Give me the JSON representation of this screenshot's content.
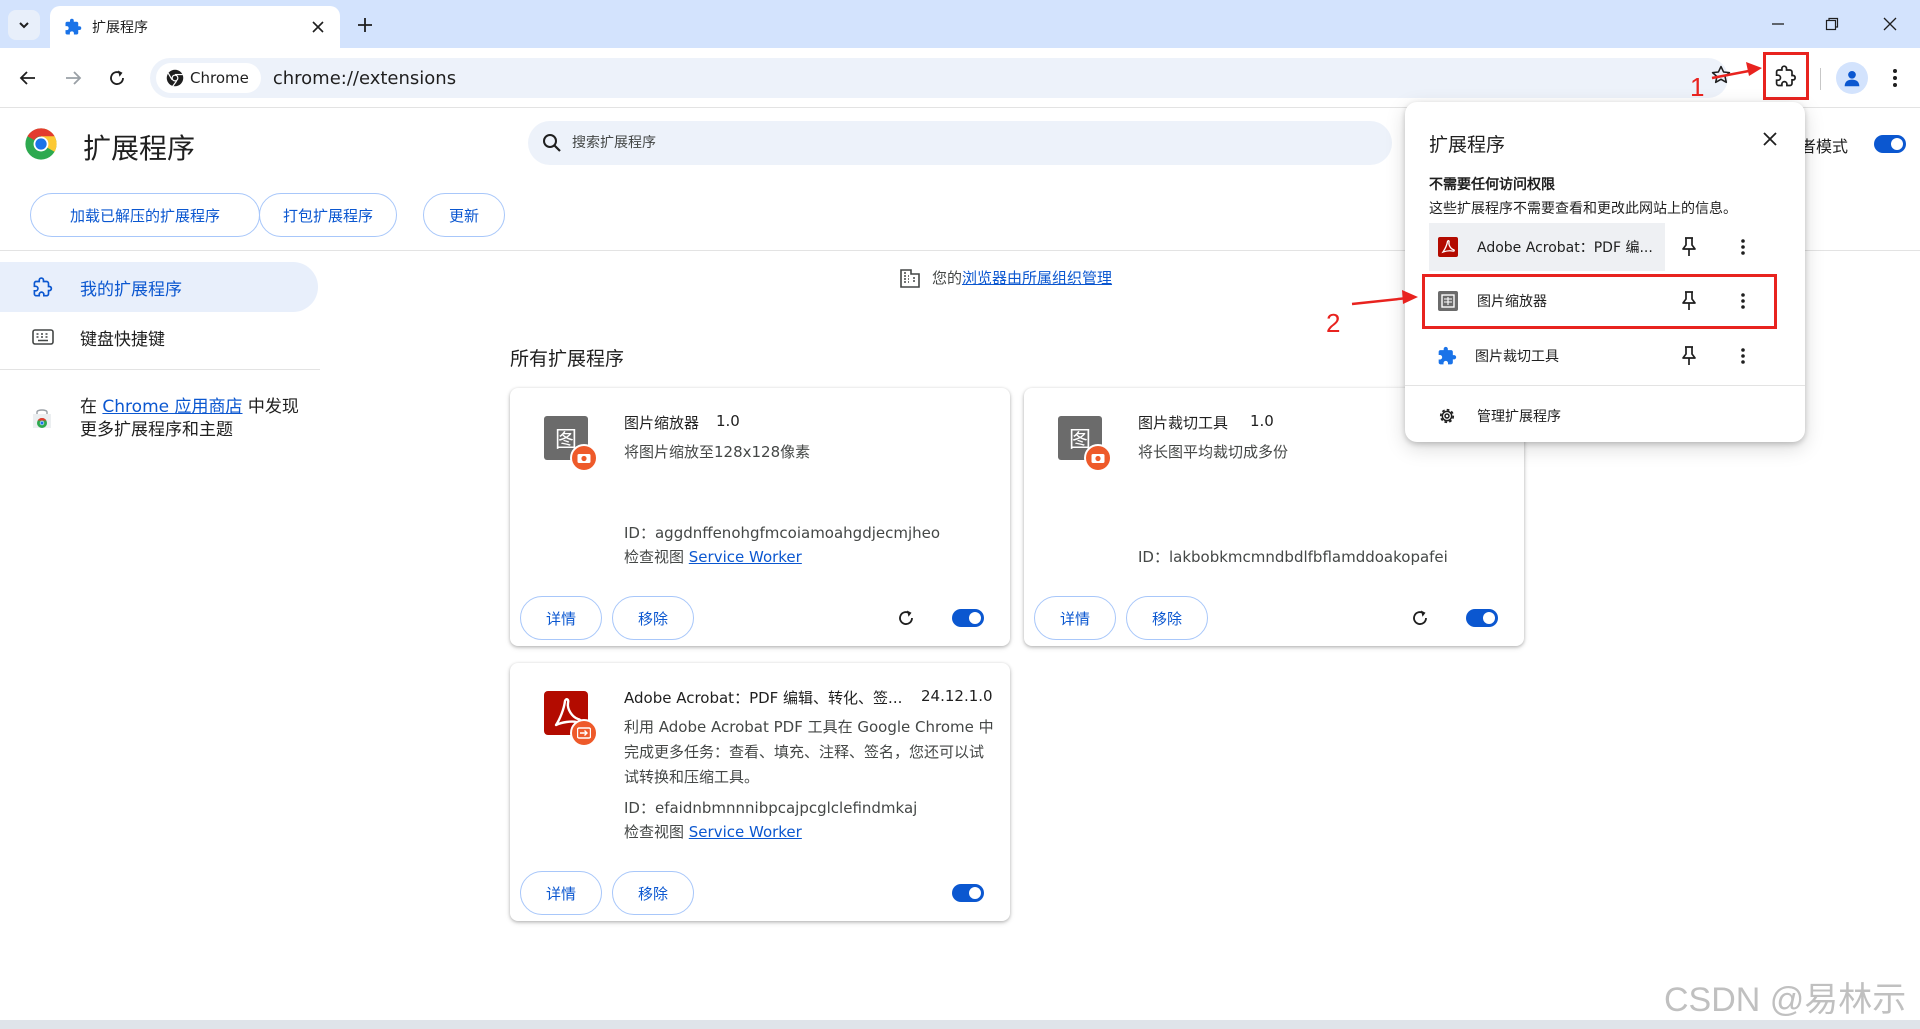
{
  "tab": {
    "title": "扩展程序"
  },
  "toolbar": {
    "chip_label": "Chrome",
    "url": "chrome://extensions"
  },
  "header": {
    "title": "扩展程序",
    "search_placeholder": "搜索扩展程序",
    "dev_mode_label": "者模式",
    "buttons": {
      "load_unpacked": "加载已解压的扩展程序",
      "pack": "打包扩展程序",
      "update": "更新"
    }
  },
  "sidebar": {
    "items": [
      {
        "label": "我的扩展程序",
        "icon": "puzzle-outline-icon"
      },
      {
        "label": "键盘快捷键",
        "icon": "keyboard-icon"
      }
    ],
    "store_promo": {
      "prefix": "在 ",
      "link": "Chrome 应用商店",
      "suffix": " 中发现",
      "line2": "更多扩展程序和主题"
    }
  },
  "managed": {
    "prefix": "您的",
    "link": "浏览器由所属组织管理"
  },
  "section_title": "所有扩展程序",
  "extensions": [
    {
      "name": "图片缩放器",
      "version": "1.0",
      "icon_char": "图",
      "description": "将图片缩放至128x128像素",
      "id_label": "ID：",
      "id": "aggdnffenohgfmcoiamoahgdjecmjheo",
      "inspect_label": "检查视图 ",
      "inspect_link": "Service Worker",
      "details": "详情",
      "remove": "移除",
      "enabled": true
    },
    {
      "name": "图片裁切工具",
      "version": "1.0",
      "icon_char": "图",
      "description": "将长图平均裁切成多份",
      "id_label": "ID：",
      "id": "lakbobkmcmndbdlfbflamddoakopafei",
      "details": "详情",
      "remove": "移除",
      "enabled": true
    },
    {
      "name": "Adobe Acrobat：PDF 编辑、转化、签...",
      "version": "24.12.1.0",
      "description": "利用 Adobe Acrobat PDF 工具在 Google Chrome 中完成更多任务：查看、填充、注释、签名，您还可以试试转换和压缩工具。",
      "id_label": "ID：",
      "id": "efaidnbmnnnibpcajpcglclefindmkaj",
      "inspect_label": "检查视图 ",
      "inspect_link": "Service Worker",
      "details": "详情",
      "remove": "移除",
      "enabled": true
    }
  ],
  "popup": {
    "title": "扩展程序",
    "subtitle": "不需要任何访问权限",
    "desc": "这些扩展程序不需要查看和更改此网站上的信息。",
    "items": [
      {
        "label": "Adobe Acrobat：PDF 编...",
        "icon": "adobe-acrobat-icon"
      },
      {
        "label": "图片缩放器",
        "icon": "image-scaler-icon"
      },
      {
        "label": "图片裁切工具",
        "icon": "puzzle-icon"
      }
    ],
    "manage": "管理扩展程序"
  },
  "annotations": {
    "step1": "1",
    "step2": "2"
  },
  "watermark": "CSDN @易林示",
  "colors": {
    "accent": "#0b57d0",
    "annotation_red": "#e8231f",
    "tabstrip": "#d3e3fd",
    "badge_orange": "#ee5a2a",
    "acrobat_red": "#b30b00"
  }
}
